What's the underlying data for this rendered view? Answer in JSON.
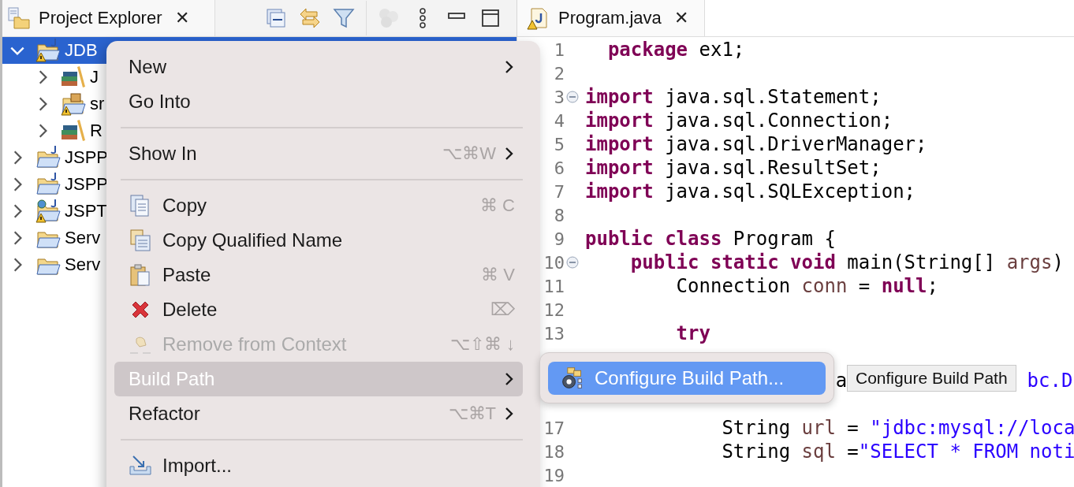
{
  "explorer": {
    "tab": {
      "title": "Project Explorer",
      "close": "✕"
    },
    "tree": [
      {
        "label": "JDB",
        "kind": "java-project",
        "warning": true,
        "expanded": true,
        "selected": true,
        "children": [
          {
            "label": "J",
            "kind": "library",
            "warning": false,
            "expanded": false,
            "selected": false
          },
          {
            "label": "sr",
            "kind": "source-folder",
            "warning": true,
            "expanded": false,
            "selected": false
          },
          {
            "label": "R",
            "kind": "library",
            "warning": false,
            "expanded": false,
            "selected": false
          }
        ]
      },
      {
        "label": "JSPP",
        "kind": "java-project",
        "warning": false,
        "expanded": false,
        "selected": false
      },
      {
        "label": "JSPP",
        "kind": "java-project",
        "warning": false,
        "expanded": false,
        "selected": false
      },
      {
        "label": "JSPT",
        "kind": "web-project",
        "warning": true,
        "expanded": false,
        "selected": false
      },
      {
        "label": "Serv",
        "kind": "folder",
        "warning": false,
        "expanded": false,
        "selected": false
      },
      {
        "label": "Serv",
        "kind": "folder",
        "warning": false,
        "expanded": false,
        "selected": false
      }
    ]
  },
  "editor": {
    "tab": {
      "title": "Program.java",
      "close": "✕"
    },
    "lines": [
      {
        "number": "1",
        "fold": false,
        "tokens": [
          {
            "kind": "keyword",
            "text": "  package"
          },
          {
            "kind": "plain",
            "text": " ex1;"
          }
        ]
      },
      {
        "number": "2",
        "fold": false
      },
      {
        "number": "3",
        "fold": true,
        "tokens": [
          {
            "kind": "keyword",
            "text": "import"
          },
          {
            "kind": "plain",
            "text": " java.sql.Statement;"
          }
        ]
      },
      {
        "number": "4",
        "fold": false,
        "tokens": [
          {
            "kind": "keyword",
            "text": "import"
          },
          {
            "kind": "plain",
            "text": " java.sql.Connection;"
          }
        ]
      },
      {
        "number": "5",
        "fold": false,
        "tokens": [
          {
            "kind": "keyword",
            "text": "import"
          },
          {
            "kind": "plain",
            "text": " java.sql.DriverManager;"
          }
        ]
      },
      {
        "number": "6",
        "fold": false,
        "tokens": [
          {
            "kind": "keyword",
            "text": "import"
          },
          {
            "kind": "plain",
            "text": " java.sql.ResultSet;"
          }
        ]
      },
      {
        "number": "7",
        "fold": false,
        "tokens": [
          {
            "kind": "keyword",
            "text": "import"
          },
          {
            "kind": "plain",
            "text": " java.sql.SQLException;"
          }
        ]
      },
      {
        "number": "8",
        "fold": false
      },
      {
        "number": "9",
        "fold": false,
        "tokens": [
          {
            "kind": "keyword",
            "text": "public class"
          },
          {
            "kind": "plain",
            "text": " Program {"
          }
        ]
      },
      {
        "number": "10",
        "fold": true,
        "tokens": [
          {
            "kind": "keyword",
            "text": "    public static void"
          },
          {
            "kind": "plain",
            "text": " main(String[] "
          },
          {
            "kind": "variable",
            "text": "args"
          },
          {
            "kind": "plain",
            "text": ")"
          }
        ]
      },
      {
        "number": "11",
        "fold": false,
        "tokens": [
          {
            "kind": "plain",
            "text": "        Connection "
          },
          {
            "kind": "variable",
            "text": "conn"
          },
          {
            "kind": "plain",
            "text": " = "
          },
          {
            "kind": "keyword",
            "text": "null"
          },
          {
            "kind": "plain",
            "text": ";"
          }
        ]
      },
      {
        "number": "12",
        "fold": false
      },
      {
        "number": "13",
        "fold": false,
        "tokens": [
          {
            "kind": "keyword",
            "text": "        try"
          }
        ]
      },
      {
        "kind": "covered"
      },
      {
        "kind": "fragments",
        "tokens": [
          {
            "kind": "plain",
            "text": "a"
          },
          {
            "kind": "string",
            "text": "bc.D"
          }
        ]
      },
      {
        "kind": "covered"
      },
      {
        "number": "17",
        "fold": false,
        "tokens": [
          {
            "kind": "plain",
            "text": "            String "
          },
          {
            "kind": "variable",
            "text": "url"
          },
          {
            "kind": "plain",
            "text": " = "
          },
          {
            "kind": "string",
            "text": "\"jdbc:mysql://loca"
          }
        ]
      },
      {
        "number": "18",
        "fold": false,
        "tokens": [
          {
            "kind": "plain",
            "text": "            String "
          },
          {
            "kind": "variable",
            "text": "sql"
          },
          {
            "kind": "plain",
            "text": " ="
          },
          {
            "kind": "string",
            "text": "\"SELECT * FROM noti"
          }
        ]
      },
      {
        "number": "19",
        "fold": false
      }
    ]
  },
  "context_menu": {
    "items": [
      {
        "kind": "plain",
        "label": "New",
        "submenu": true,
        "disabled": false,
        "selected": false
      },
      {
        "kind": "plain",
        "label": "Go Into",
        "submenu": false,
        "disabled": false,
        "selected": false
      },
      {
        "kind": "separator"
      },
      {
        "kind": "plain",
        "label": "Show In",
        "shortcut": "⌥⌘W",
        "submenu": true,
        "disabled": false,
        "selected": false
      },
      {
        "kind": "separator"
      },
      {
        "kind": "copy",
        "label": "Copy",
        "shortcut": "⌘ C",
        "submenu": false,
        "disabled": false,
        "selected": false
      },
      {
        "kind": "copy-qualified",
        "label": "Copy Qualified Name",
        "submenu": false,
        "disabled": false,
        "selected": false
      },
      {
        "kind": "paste",
        "label": "Paste",
        "shortcut": "⌘ V",
        "submenu": false,
        "disabled": false,
        "selected": false
      },
      {
        "kind": "delete",
        "label": "Delete",
        "shortcut": "⌦",
        "submenu": false,
        "disabled": false,
        "selected": false
      },
      {
        "kind": "remove",
        "label": "Remove from Context",
        "shortcut": "⌥⇧⌘ ↓",
        "submenu": false,
        "disabled": true,
        "selected": false
      },
      {
        "kind": "plain",
        "label": "Build Path",
        "submenu": true,
        "disabled": false,
        "selected": true
      },
      {
        "kind": "plain",
        "label": "Refactor",
        "shortcut": "⌥⌘T",
        "submenu": true,
        "disabled": false,
        "selected": false
      },
      {
        "kind": "separator"
      },
      {
        "kind": "import",
        "label": "Import...",
        "submenu": false,
        "disabled": false,
        "selected": false
      }
    ]
  },
  "submenu": {
    "items": [
      {
        "label": "Configure Build Path...",
        "selected": true
      }
    ]
  },
  "tooltip": {
    "text": "Configure Build Path"
  }
}
